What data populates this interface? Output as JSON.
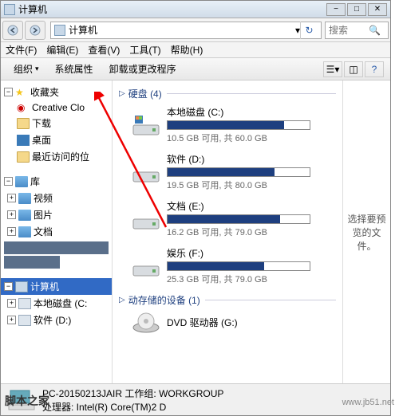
{
  "window": {
    "title": "计算机"
  },
  "nav": {
    "address": "计算机",
    "search_placeholder": "搜索"
  },
  "menu": {
    "file": "文件(F)",
    "edit": "编辑(E)",
    "view": "查看(V)",
    "tools": "工具(T)",
    "help": "帮助(H)"
  },
  "toolbar": {
    "organize": "组织",
    "sysprops": "系统属性",
    "uninstall": "卸载或更改程序"
  },
  "sidebar": {
    "favorites": {
      "label": "收藏夹",
      "items": [
        "Creative Clo",
        "下载",
        "桌面",
        "最近访问的位"
      ]
    },
    "libraries": {
      "label": "库",
      "items": [
        "视频",
        "图片",
        "文档"
      ]
    },
    "computer": {
      "label": "计算机",
      "items": [
        "本地磁盘 (C:",
        "软件 (D:)"
      ]
    }
  },
  "main": {
    "group_hdd": {
      "label": "硬盘",
      "count": "(4)"
    },
    "group_removable": {
      "label": "动存储的设备",
      "count": "(1)"
    },
    "drives": [
      {
        "name": "本地磁盘 (C:)",
        "stats": "10.5 GB 可用, 共 60.0 GB",
        "fill": 82
      },
      {
        "name": "软件 (D:)",
        "stats": "19.5 GB 可用, 共 80.0 GB",
        "fill": 75
      },
      {
        "name": "文档 (E:)",
        "stats": "16.2 GB 可用, 共 79.0 GB",
        "fill": 79
      },
      {
        "name": "娱乐 (F:)",
        "stats": "25.3 GB 可用, 共 79.0 GB",
        "fill": 68
      }
    ],
    "dvd": {
      "name": "DVD 驱动器 (G:)"
    }
  },
  "preview": {
    "text": "选择要预览的文件。"
  },
  "status": {
    "line1": "PC-20150213JAIR 工作组: WORKGROUP",
    "line2": "处理器: Intel(R) Core(TM)2 D"
  },
  "watermark": "www.jb51.net",
  "logo": "脚本之家"
}
